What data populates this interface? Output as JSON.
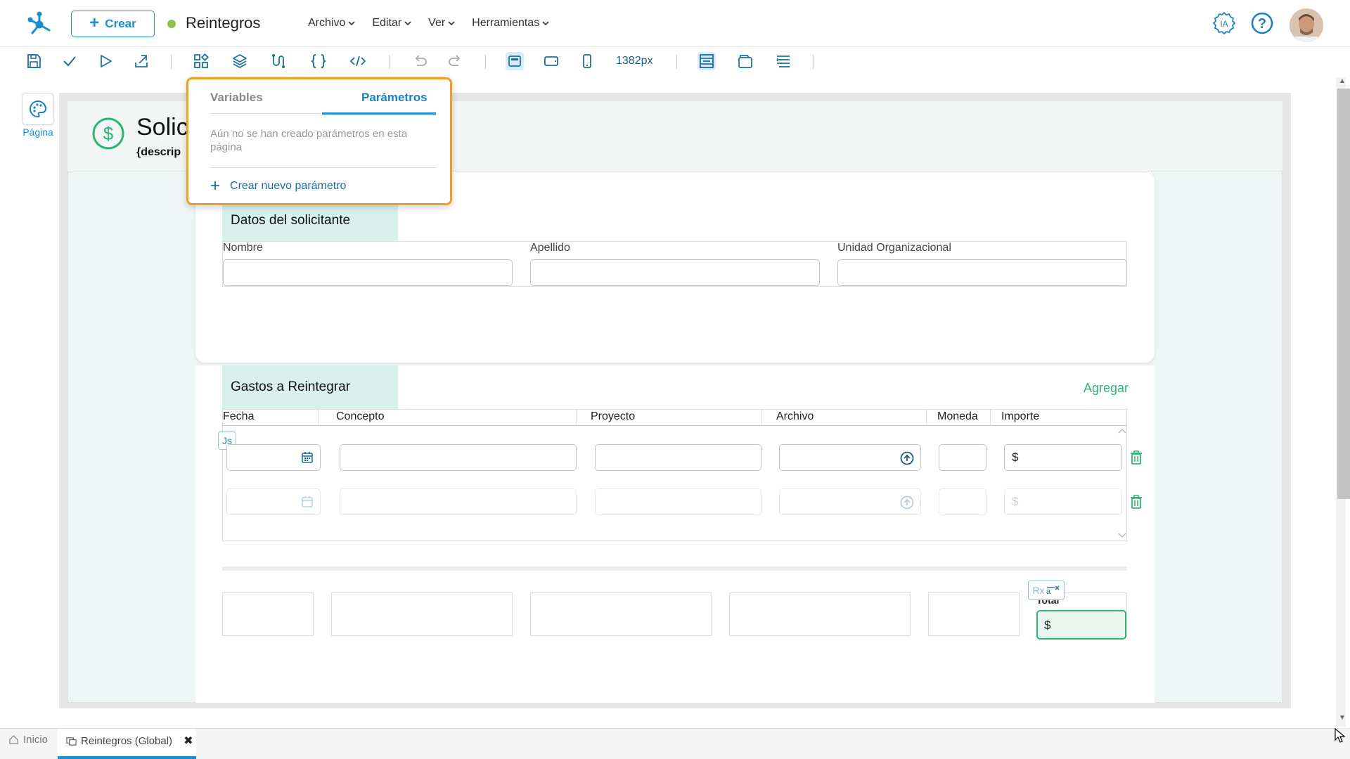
{
  "topbar": {
    "create_label": "Crear",
    "doc_title": "Reintegros",
    "status_color": "#8bc34a",
    "menu": [
      {
        "label": "Archivo"
      },
      {
        "label": "Editar"
      },
      {
        "label": "Ver"
      },
      {
        "label": "Herramientas"
      }
    ],
    "ia_label": "IA",
    "help_icon": "help-circle-icon"
  },
  "toolbar": {
    "width_label": "1382px",
    "icons": [
      "save-icon",
      "check-icon",
      "play-icon",
      "export-icon",
      "components-icon",
      "layers-icon",
      "flow-icon",
      "braces-icon",
      "code-icon",
      "undo-icon",
      "redo-icon",
      "desktop-view-icon",
      "tablet-view-icon",
      "mobile-view-icon",
      "layout-icon",
      "window-icon",
      "align-icon"
    ]
  },
  "side": {
    "page_label": "Página"
  },
  "page_header": {
    "title": "Solic",
    "subtitle": "{descrip"
  },
  "popover": {
    "tabs": [
      "Variables",
      "Parámetros"
    ],
    "active_tab": "Parámetros",
    "empty_text": "Aún no se han creado parámetros en esta página",
    "create_label": "Crear nuevo parámetro"
  },
  "section_applicant": {
    "title": "Datos del solicitante",
    "fields": [
      {
        "label": "Nombre",
        "value": ""
      },
      {
        "label": "Apellido",
        "value": ""
      },
      {
        "label": "Unidad Organizacional",
        "value": ""
      }
    ]
  },
  "section_expenses": {
    "title": "Gastos a Reintegrar",
    "add_label": "Agregar",
    "columns": [
      "Fecha",
      "Concepto",
      "Proyecto",
      "Archivo",
      "Moneda",
      "Importe"
    ],
    "currency_symbol": "$",
    "js_badge": "Js",
    "accent_color": "#2bb673"
  },
  "totals": {
    "label": "Total",
    "currency_symbol": "$",
    "rx_badge": "Rx"
  },
  "bottom_tabs": [
    {
      "label": "Inicio",
      "active": false
    },
    {
      "label": "Reintegros (Global)",
      "active": true
    }
  ]
}
